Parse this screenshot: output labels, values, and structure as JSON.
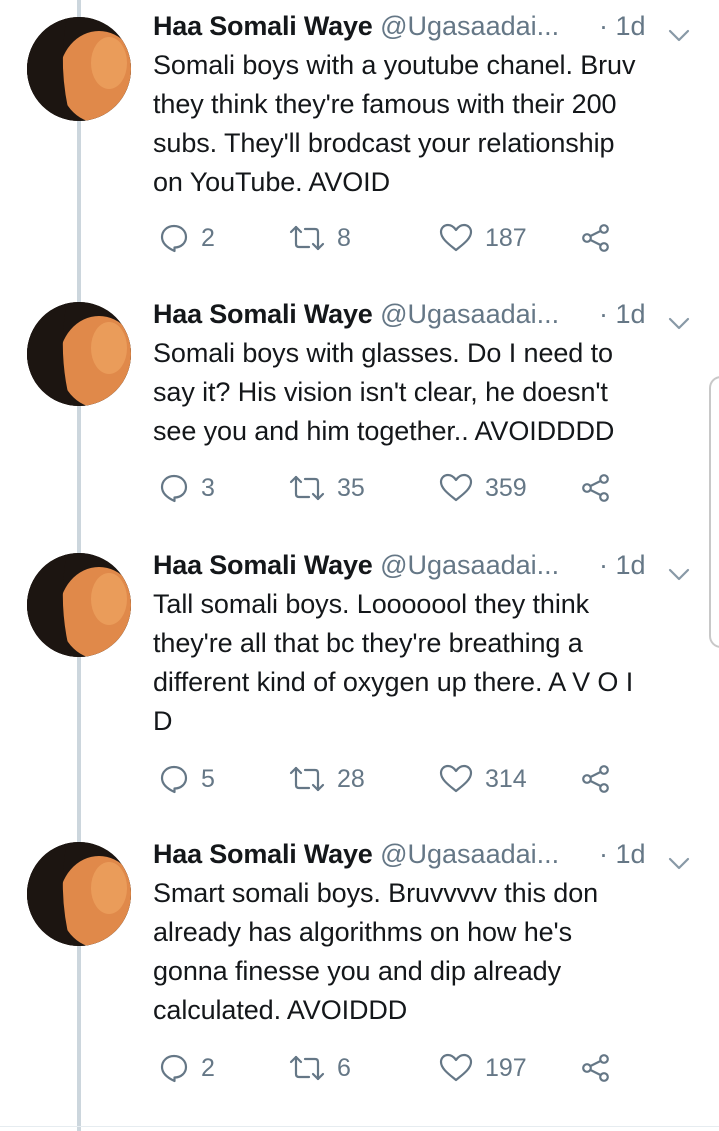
{
  "colors": {
    "text": "#14171a",
    "muted": "#657786",
    "thread": "#ccd6dd",
    "avatar_skin": "#e0894a"
  },
  "icons": {
    "reply": "reply-icon",
    "retweet": "retweet-icon",
    "like": "heart-icon",
    "share": "share-icon",
    "menu": "chevron-down-icon"
  },
  "tweets": [
    {
      "name": "Haa Somali Waye",
      "handle": "@Ugasaadai...",
      "time": "· 1d",
      "lines": [
        "Somali boys with a youtube chanel. Bruv",
        "they think they're famous with their 200",
        "subs. They'll brodcast your relationship",
        "on YouTube. AVOID"
      ],
      "replies": "2",
      "retweets": "8",
      "likes": "187"
    },
    {
      "name": "Haa Somali Waye",
      "handle": "@Ugasaadai...",
      "time": "· 1d",
      "lines": [
        "Somali boys with glasses. Do I need to",
        "say it? His vision isn't clear, he doesn't",
        "see you and him together.. AVOIDDDD"
      ],
      "replies": "3",
      "retweets": "35",
      "likes": "359"
    },
    {
      "name": "Haa Somali Waye",
      "handle": "@Ugasaadai...",
      "time": "· 1d",
      "lines": [
        "Tall somali boys. Looooool they think",
        "they're all that bc they're breathing a",
        "different kind of oxygen up there. A V O I",
        "D"
      ],
      "replies": "5",
      "retweets": "28",
      "likes": "314"
    },
    {
      "name": "Haa Somali Waye",
      "handle": "@Ugasaadai...",
      "time": "· 1d",
      "lines": [
        "Smart somali boys. Bruvvvvv this don",
        "already has algorithms on how he's",
        "gonna finesse you and dip already",
        "calculated. AVOIDDD"
      ],
      "replies": "2",
      "retweets": "6",
      "likes": "197"
    }
  ]
}
